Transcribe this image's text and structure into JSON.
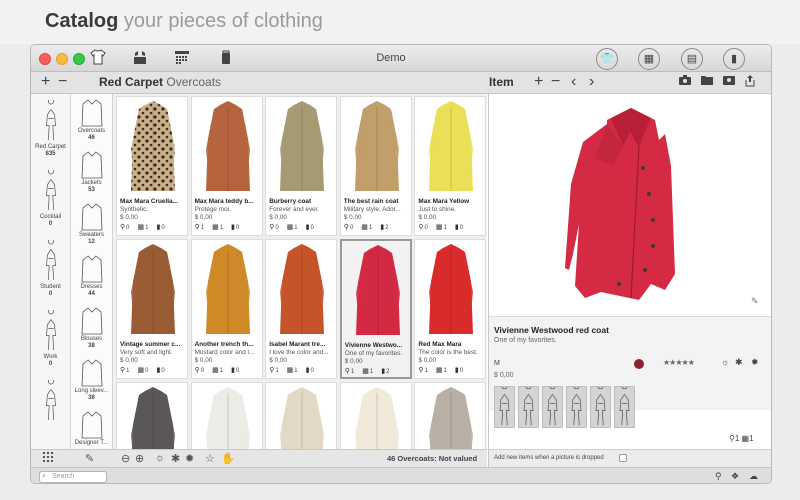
{
  "banner": {
    "title_bold": "Catalog",
    "title_rest": "your pieces of clothing"
  },
  "window": {
    "title": "Demo"
  },
  "toolbar": {
    "left_icons": [
      "shirt-icon",
      "wardrobe-icon",
      "calendar-grid-icon",
      "suitcase-icon"
    ],
    "right_icons": [
      "shirt-circle-icon",
      "wardrobe-circle-icon",
      "calendar-circle-icon",
      "suitcase-circle-icon"
    ]
  },
  "secbar": {
    "add": "+",
    "remove": "−",
    "title_bold": "Red Carpet",
    "title_rest": "Overcoats",
    "item_title": "Item",
    "item_add": "+",
    "item_remove": "−",
    "prev": "‹",
    "next": "›"
  },
  "looks": [
    {
      "label": "Red Carpet",
      "count": "835"
    },
    {
      "label": "Cocktail",
      "count": "0"
    },
    {
      "label": "Student",
      "count": "0"
    },
    {
      "label": "Work",
      "count": "0"
    },
    {
      "label": "",
      "count": ""
    }
  ],
  "categories": [
    {
      "label": "Overcoats",
      "count": "46"
    },
    {
      "label": "Jackets",
      "count": "53"
    },
    {
      "label": "Sweaters",
      "count": "12"
    },
    {
      "label": "Dresses",
      "count": "44"
    },
    {
      "label": "Blouses",
      "count": "38"
    },
    {
      "label": "Long sleev...",
      "count": "36"
    },
    {
      "label": "Designer T...",
      "count": ""
    }
  ],
  "items": [
    {
      "name": "Max Mara Cruella...",
      "desc": "Synthetic.",
      "price": "$ 0,00",
      "m1": "0",
      "m2": "1",
      "m3": "0",
      "color": "leopard",
      "selected": false
    },
    {
      "name": "Max Mara teddy b...",
      "desc": "Protège moi.",
      "price": "$ 0,00",
      "m1": "1",
      "m2": "1",
      "m3": "0",
      "color": "#b5643e",
      "selected": false
    },
    {
      "name": "Burberry coat",
      "desc": "Forever and ever.",
      "price": "$ 0,00",
      "m1": "0",
      "m2": "1",
      "m3": "0",
      "color": "#a69a72",
      "selected": false
    },
    {
      "name": "The best rain coat",
      "desc": "Military style. Ador...",
      "price": "$ 0,00",
      "m1": "0",
      "m2": "1",
      "m3": "2",
      "color": "#c19e6a",
      "selected": false
    },
    {
      "name": "Max Mara Yellow",
      "desc": "Just to shine.",
      "price": "$ 0,00",
      "m1": "0",
      "m2": "1",
      "m3": "0",
      "color": "#eadf57",
      "selected": false
    },
    {
      "name": "Vintage summer c...",
      "desc": "Very soft and light.",
      "price": "$ 0,00",
      "m1": "1",
      "m2": "0",
      "m3": "0",
      "color": "#9a5c35",
      "selected": false
    },
    {
      "name": "Another trench th...",
      "desc": "Mustard color and l...",
      "price": "$ 0,00",
      "m1": "0",
      "m2": "1",
      "m3": "0",
      "color": "#cf8a27",
      "selected": false
    },
    {
      "name": "Isabel Marant tre...",
      "desc": "I love the color and...",
      "price": "$ 0,00",
      "m1": "1",
      "m2": "1",
      "m3": "0",
      "color": "#c6542b",
      "selected": false
    },
    {
      "name": "Vivienne Westwo...",
      "desc": "One of my favorites.",
      "price": "$ 0,00",
      "m1": "1",
      "m2": "1",
      "m3": "2",
      "color": "#d32a44",
      "selected": true
    },
    {
      "name": "Red Max Mara",
      "desc": "The color is the best.",
      "price": "$ 0,00",
      "m1": "1",
      "m2": "1",
      "m3": "0",
      "color": "#d92b2b",
      "selected": false
    },
    {
      "name": "",
      "desc": "",
      "price": "",
      "m1": "",
      "m2": "",
      "m3": "",
      "color": "#5b5757",
      "selected": false
    },
    {
      "name": "",
      "desc": "",
      "price": "",
      "m1": "",
      "m2": "",
      "m3": "",
      "color": "#ecebe6",
      "selected": false
    },
    {
      "name": "",
      "desc": "",
      "price": "",
      "m1": "",
      "m2": "",
      "m3": "",
      "color": "#e3d8c6",
      "selected": false
    },
    {
      "name": "",
      "desc": "",
      "price": "",
      "m1": "",
      "m2": "",
      "m3": "",
      "color": "#f1e9da",
      "selected": false
    },
    {
      "name": "",
      "desc": "",
      "price": "",
      "m1": "",
      "m2": "",
      "m3": "",
      "color": "#b8b0a4",
      "selected": false
    }
  ],
  "bottombar": {
    "status": "46 Overcoats: Not valued"
  },
  "status": {
    "search_placeholder": "Search"
  },
  "detail": {
    "name": "Vivienne Westwood red coat",
    "desc": "One of my favorites.",
    "size": "M",
    "price": "$ 0,00",
    "rating": "★★★★★",
    "rating_value": 0,
    "color": "#8e1f34",
    "coat_color": "#d42a44",
    "note": "Add new items when a picture is dropped",
    "foot_counts": [
      "1",
      "1"
    ]
  }
}
